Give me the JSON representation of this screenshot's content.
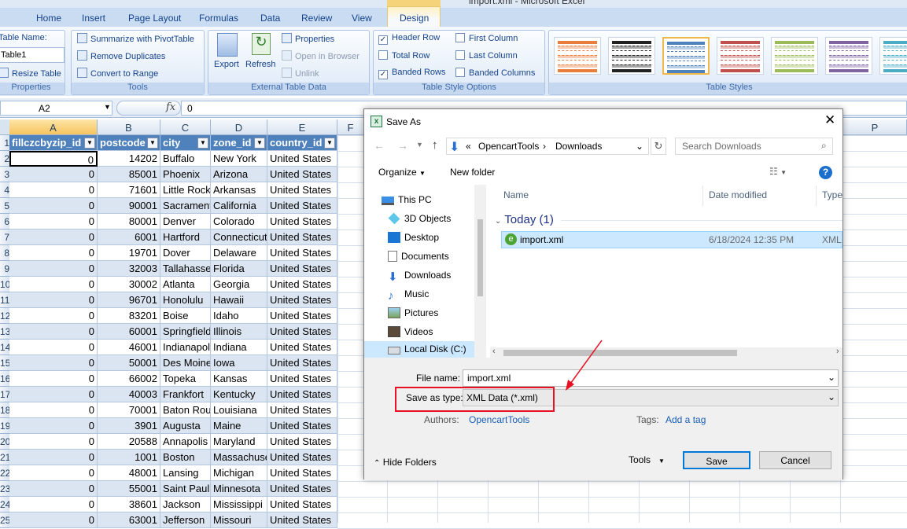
{
  "window_title": "import.xml - Microsoft Excel",
  "context_tab": "Table Tools",
  "ribbon": {
    "tabs": [
      "Home",
      "Insert",
      "Page Layout",
      "Formulas",
      "Data",
      "Review",
      "View",
      "Design"
    ],
    "properties": {
      "table_name_label": "Table Name:",
      "table_name": "Table1",
      "resize": "Resize Table",
      "group": "Properties"
    },
    "tools": {
      "summarize": "Summarize with PivotTable",
      "remove_dup": "Remove Duplicates",
      "convert": "Convert to Range",
      "group": "Tools"
    },
    "external": {
      "export": "Export",
      "refresh": "Refresh",
      "properties": "Properties",
      "open_browser": "Open in Browser",
      "unlink": "Unlink",
      "group": "External Table Data"
    },
    "style_options": {
      "header_row": "Header Row",
      "total_row": "Total Row",
      "banded_rows": "Banded Rows",
      "first_column": "First Column",
      "last_column": "Last Column",
      "banded_columns": "Banded Columns",
      "group": "Table Style Options",
      "header_row_checked": true,
      "total_row_checked": false,
      "banded_rows_checked": true,
      "first_column_checked": false,
      "last_column_checked": false,
      "banded_columns_checked": false
    },
    "table_styles": {
      "group": "Table Styles",
      "colors": [
        "#e97e3c",
        "#222222",
        "#4f81bd",
        "#c0504d",
        "#9bbb59",
        "#8064a2",
        "#4bacc6"
      ]
    }
  },
  "formula_bar": {
    "name_box": "A2",
    "fx": "fx",
    "content": "0"
  },
  "sheet": {
    "col_letters": [
      "A",
      "B",
      "C",
      "D",
      "E",
      "F",
      "P"
    ],
    "row_numbers": [
      "1",
      "2",
      "3",
      "4",
      "5",
      "6",
      "7",
      "8",
      "9",
      "10",
      "11",
      "12",
      "13",
      "14",
      "15",
      "16",
      "17",
      "18",
      "19",
      "20",
      "21",
      "22",
      "23",
      "24",
      "25"
    ],
    "headers": [
      "fillczcbyzip_id",
      "postcode",
      "city",
      "zone_id",
      "country_id"
    ],
    "rows": [
      [
        "0",
        "14202",
        "Buffalo",
        "New York",
        "United States"
      ],
      [
        "0",
        "85001",
        "Phoenix",
        "Arizona",
        "United States"
      ],
      [
        "0",
        "71601",
        "Little Rock",
        "Arkansas",
        "United States"
      ],
      [
        "0",
        "90001",
        "Sacramento",
        "California",
        "United States"
      ],
      [
        "0",
        "80001",
        "Denver",
        "Colorado",
        "United States"
      ],
      [
        "0",
        "6001",
        "Hartford",
        "Connecticut",
        "United States"
      ],
      [
        "0",
        "19701",
        "Dover",
        "Delaware",
        "United States"
      ],
      [
        "0",
        "32003",
        "Tallahassee",
        "Florida",
        "United States"
      ],
      [
        "0",
        "30002",
        "Atlanta",
        "Georgia",
        "United States"
      ],
      [
        "0",
        "96701",
        "Honolulu",
        "Hawaii",
        "United States"
      ],
      [
        "0",
        "83201",
        "Boise",
        "Idaho",
        "United States"
      ],
      [
        "0",
        "60001",
        "Springfield",
        "Illinois",
        "United States"
      ],
      [
        "0",
        "46001",
        "Indianapolis",
        "Indiana",
        "United States"
      ],
      [
        "0",
        "50001",
        "Des Moines",
        "Iowa",
        "United States"
      ],
      [
        "0",
        "66002",
        "Topeka",
        "Kansas",
        "United States"
      ],
      [
        "0",
        "40003",
        "Frankfort",
        "Kentucky",
        "United States"
      ],
      [
        "0",
        "70001",
        "Baton Rouge",
        "Louisiana",
        "United States"
      ],
      [
        "0",
        "3901",
        "Augusta",
        "Maine",
        "United States"
      ],
      [
        "0",
        "20588",
        "Annapolis",
        "Maryland",
        "United States"
      ],
      [
        "0",
        "1001",
        "Boston",
        "Massachusetts",
        "United States"
      ],
      [
        "0",
        "48001",
        "Lansing",
        "Michigan",
        "United States"
      ],
      [
        "0",
        "55001",
        "Saint Paul",
        "Minnesota",
        "United States"
      ],
      [
        "0",
        "38601",
        "Jackson",
        "Mississippi",
        "United States"
      ],
      [
        "0",
        "63001",
        "Jefferson",
        "Missouri",
        "United States"
      ]
    ]
  },
  "dialog": {
    "title": "Save As",
    "path_prefix": "«",
    "path": [
      "OpencartTools",
      "Downloads"
    ],
    "search_placeholder": "Search Downloads",
    "organize": "Organize",
    "new_folder": "New folder",
    "nav": [
      "This PC",
      "3D Objects",
      "Desktop",
      "Documents",
      "Downloads",
      "Music",
      "Pictures",
      "Videos",
      "Local Disk (C:)"
    ],
    "columns": {
      "name": "Name",
      "date": "Date modified",
      "type": "Type"
    },
    "group_label": "Today (1)",
    "file": {
      "name": "import.xml",
      "date": "6/18/2024 12:35 PM",
      "type": "XML"
    },
    "file_name_label": "File name:",
    "file_name": "import.xml",
    "save_type_label": "Save as type:",
    "save_type": "XML Data (*.xml)",
    "authors_label": "Authors:",
    "authors": "OpencartTools",
    "tags_label": "Tags:",
    "tags": "Add a tag",
    "hide_folders": "Hide Folders",
    "tools": "Tools",
    "save": "Save",
    "cancel": "Cancel",
    "annotation_color": "#e81123"
  }
}
